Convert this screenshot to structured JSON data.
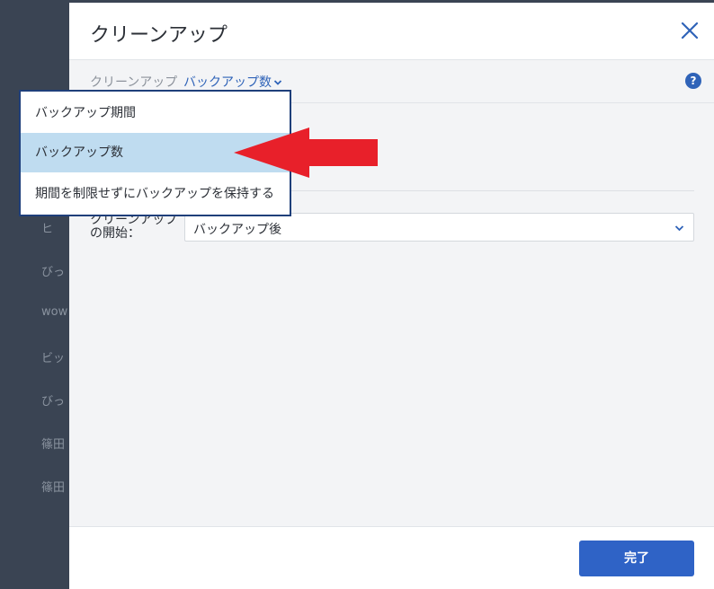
{
  "background_list": [
    "ヒ",
    "びっ",
    "wow",
    "ビッ",
    "びっ",
    "篠田",
    "篠田"
  ],
  "modal": {
    "title": "クリーンアップ",
    "breadcrumb_label": "クリーンアップ",
    "breadcrumb_selected": "バックアップ数",
    "field_label": "クリーンアップの開始：",
    "select_value": "バックアップ後",
    "done_label": "完了"
  },
  "dropdown": {
    "items": [
      "バックアップ期間",
      "バックアップ数",
      "期間を制限せずにバックアップを保持する"
    ],
    "selected_index": 1
  },
  "colors": {
    "accent": "#2f63b8",
    "selected_bg": "#bfdcf0",
    "arrow": "#e8202a"
  },
  "icons": [
    "close-icon",
    "chevron-down-icon",
    "help-icon",
    "red-arrow-annotation"
  ]
}
